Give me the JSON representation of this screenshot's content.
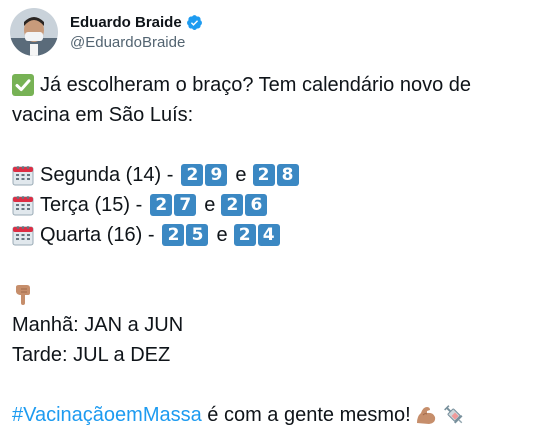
{
  "author": {
    "display_name": "Eduardo Braide",
    "handle": "@EduardoBraide",
    "verified": true
  },
  "tweet": {
    "line1": "Já escolheram o braço? Tem calendário novo de",
    "line2": "vacina em São Luís:",
    "schedule": [
      {
        "day": "Segunda (14) -",
        "group_a": [
          "2",
          "9"
        ],
        "connector": "e",
        "group_b": [
          "2",
          "8"
        ]
      },
      {
        "day": "Terça (15) -",
        "group_a": [
          "2",
          "7"
        ],
        "connector": "e",
        "group_b": [
          "2",
          "6"
        ]
      },
      {
        "day": "Quarta (16) -",
        "group_a": [
          "2",
          "5"
        ],
        "connector": "e",
        "group_b": [
          "2",
          "4"
        ]
      }
    ],
    "morning": "Manhã: JAN a JUN",
    "afternoon": "Tarde: JUL a DEZ",
    "hashtag": "#VacinaçãoemMassa",
    "closing": " é com a gente mesmo!"
  },
  "icons": {
    "check": "check-mark-button-icon",
    "calendar": "calendar-icon",
    "pointing_down": "backhand-index-pointing-down-icon",
    "flexed_biceps": "flexed-biceps-icon",
    "syringe": "syringe-icon"
  },
  "colors": {
    "hashtag": "#1d9bf0",
    "keycap": "#3b88c3",
    "verified": "#1d9bf0",
    "text": "#0f1419",
    "handle": "#536471"
  }
}
